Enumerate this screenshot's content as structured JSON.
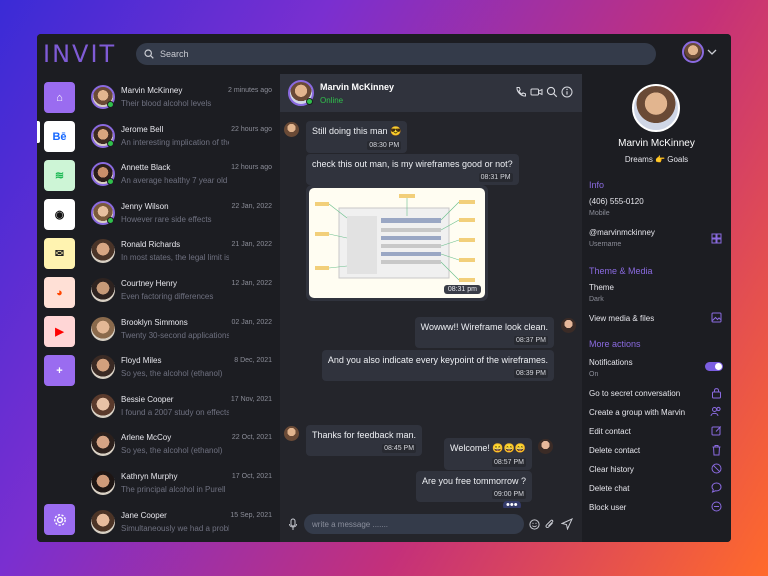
{
  "app": {
    "logo": "INVIT"
  },
  "search": {
    "placeholder": "Search"
  },
  "colors": {
    "accent": "#7b5ee0",
    "online": "#30c04c",
    "panel": "#1c1d22",
    "bubble": "#30333d"
  },
  "rail": {
    "apps": [
      {
        "name": "home-icon",
        "bg": "#9a6cf0",
        "glyph": "⌂"
      },
      {
        "name": "behance-icon",
        "bg": "#ffffff",
        "glyph": "Bē"
      },
      {
        "name": "spotify-icon",
        "bg": "#cdf5d6",
        "glyph": "≋"
      },
      {
        "name": "github-icon",
        "bg": "#ffffff",
        "glyph": "◉"
      },
      {
        "name": "mailchimp-icon",
        "bg": "#fff3b0",
        "glyph": "✉"
      },
      {
        "name": "reddit-icon",
        "bg": "#ffe0d6",
        "glyph": "◕"
      },
      {
        "name": "youtube-icon",
        "bg": "#ffd6d6",
        "glyph": "▶"
      },
      {
        "name": "add-icon",
        "bg": "#9a6cf0",
        "glyph": "+"
      }
    ],
    "settings": "settings-icon"
  },
  "contacts": [
    {
      "name": "Marvin McKinney",
      "preview": "Their blood alcohol levels",
      "time": "2 minutes ago",
      "online": true
    },
    {
      "name": "Jerome Bell",
      "preview": "An interesting implication of the",
      "time": "22 hours ago",
      "online": true
    },
    {
      "name": "Annette Black",
      "preview": "An average healthy 7 year old",
      "time": "12 hours ago",
      "online": true
    },
    {
      "name": "Jenny Wilson",
      "preview": "However rare side effects",
      "time": "22 Jan, 2022",
      "online": true
    },
    {
      "name": "Ronald Richards",
      "preview": "In most states, the legal limit is",
      "time": "21 Jan, 2022",
      "online": false
    },
    {
      "name": "Courtney Henry",
      "preview": "Even factoring differences",
      "time": "12 Jan, 2022",
      "online": false
    },
    {
      "name": "Brooklyn Simmons",
      "preview": "Twenty 30-second applications",
      "time": "02 Jan, 2022",
      "online": false
    },
    {
      "name": "Floyd Miles",
      "preview": "So yes, the alcohol (ethanol)",
      "time": "8 Dec, 2021",
      "online": false
    },
    {
      "name": "Bessie Cooper",
      "preview": "I found a 2007 study on effects",
      "time": "17 Nov, 2021",
      "online": false
    },
    {
      "name": "Arlene McCoy",
      "preview": "So yes, the alcohol (ethanol)",
      "time": "22 Oct, 2021",
      "online": false
    },
    {
      "name": "Kathryn Murphy",
      "preview": "The principal alcohol in Purell",
      "time": "17 Oct, 2021",
      "online": false
    },
    {
      "name": "Jane Cooper",
      "preview": "Simultaneously we had a problem",
      "time": "15 Sep, 2021",
      "online": false
    }
  ],
  "chat": {
    "name": "Marvin McKinney",
    "status": "Online",
    "messages": [
      {
        "text": "Still doing this man 😎",
        "time": "08:30 PM"
      },
      {
        "text": "check this out man, is my wireframes good or not?",
        "time": "08:31 PM"
      },
      {
        "image_time": "08:31 pm"
      },
      {
        "text": "Wowww!! Wireframe look clean.",
        "time": "08:37 PM"
      },
      {
        "text": "And you also indicate every keypoint of the wireframes.",
        "time": "08:39 PM"
      },
      {
        "text": "Thanks for feedback man.",
        "time": "08:45 PM"
      },
      {
        "text": "Welcome! 😄😄😄",
        "time": "08:57 PM"
      },
      {
        "text": "Are you free tommorrow ?",
        "time": "09:00 PM"
      }
    ],
    "typing": "•••",
    "input_placeholder": "write a message ......."
  },
  "profile": {
    "name": "Marvin McKinney",
    "bio": "Dreams 👉 Goals",
    "info_title": "Info",
    "phone": "(406) 555-0120",
    "phone_label": "Mobile",
    "username": "@marvinmckinney",
    "username_label": "Username",
    "theme_title": "Theme & Media",
    "theme": "Theme",
    "theme_value": "Dark",
    "media": "View media & files",
    "actions_title": "More actions",
    "notifications": "Notifications",
    "notifications_value": "On",
    "secret": "Go to secret conversation",
    "group": "Create a group with Marvin",
    "edit": "Edit contact",
    "delete_contact": "Delete contact",
    "clear": "Clear history",
    "delete_chat": "Delete chat",
    "block": "Block user"
  }
}
